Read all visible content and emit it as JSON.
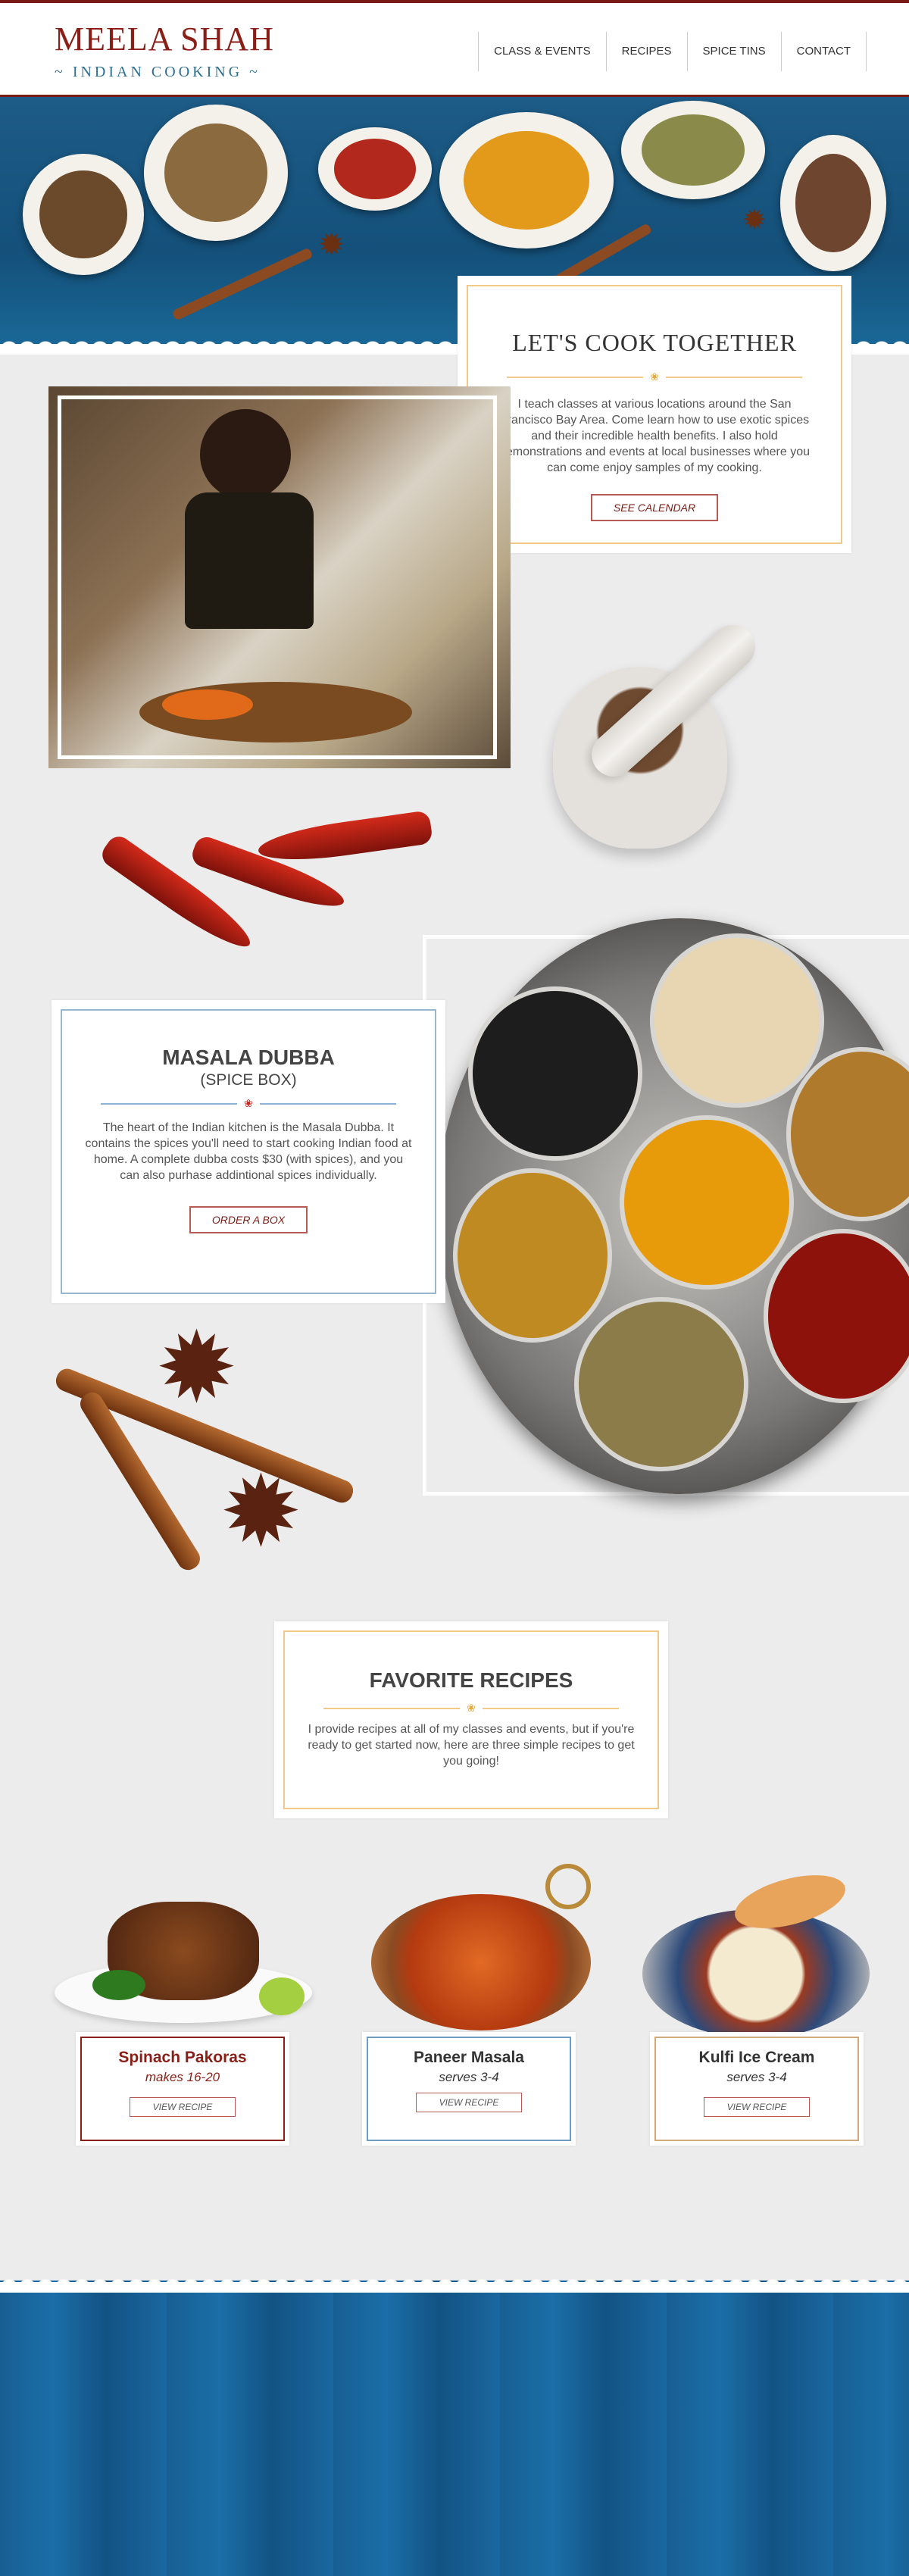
{
  "header": {
    "title": "MEELA SHAH",
    "subtitle": "~ INDIAN COOKING ~",
    "nav": [
      {
        "label": "CLASS & EVENTS"
      },
      {
        "label": "RECIPES"
      },
      {
        "label": "SPICE TINS"
      },
      {
        "label": "CONTACT"
      }
    ]
  },
  "cook_together": {
    "title": "LET'S COOK TOGETHER",
    "text": "I teach classes at various locations around the San Francisco Bay Area. Come learn how to use exotic spices and their incredible health benefits. I also hold demonstrations and events at local businesses where you can come enjoy samples of my cooking.",
    "button": "SEE CALENDAR"
  },
  "masala_dubba": {
    "title": "MASALA DUBBA",
    "subtitle": "(SPICE BOX)",
    "text": "The heart of the Indian kitchen is the Masala Dubba. It contains the spices you'll need to start cooking Indian food at home. A complete dubba costs $30 (with spices), and you can also purhase addintional spices individually.",
    "button": "ORDER A BOX"
  },
  "favorite_recipes": {
    "title": "FAVORITE RECIPES",
    "text": "I provide recipes at all of my classes and events, but if you're ready to get started now, here are three simple recipes to get you going!"
  },
  "recipes": [
    {
      "name": "Spinach Pakoras",
      "serves": "makes 16-20",
      "button": "VIEW RECIPE"
    },
    {
      "name": "Paneer Masala",
      "serves": "serves 3-4",
      "button": "VIEW RECIPE"
    },
    {
      "name": "Kulfi Ice Cream",
      "serves": "serves 3-4",
      "button": "VIEW RECIPE"
    }
  ],
  "colors": {
    "brand_red": "#8a1f18",
    "brand_blue": "#2d6f8f",
    "accent_gold": "#f2c98a",
    "background": "#ececec",
    "footer_blue": "#175f93"
  }
}
